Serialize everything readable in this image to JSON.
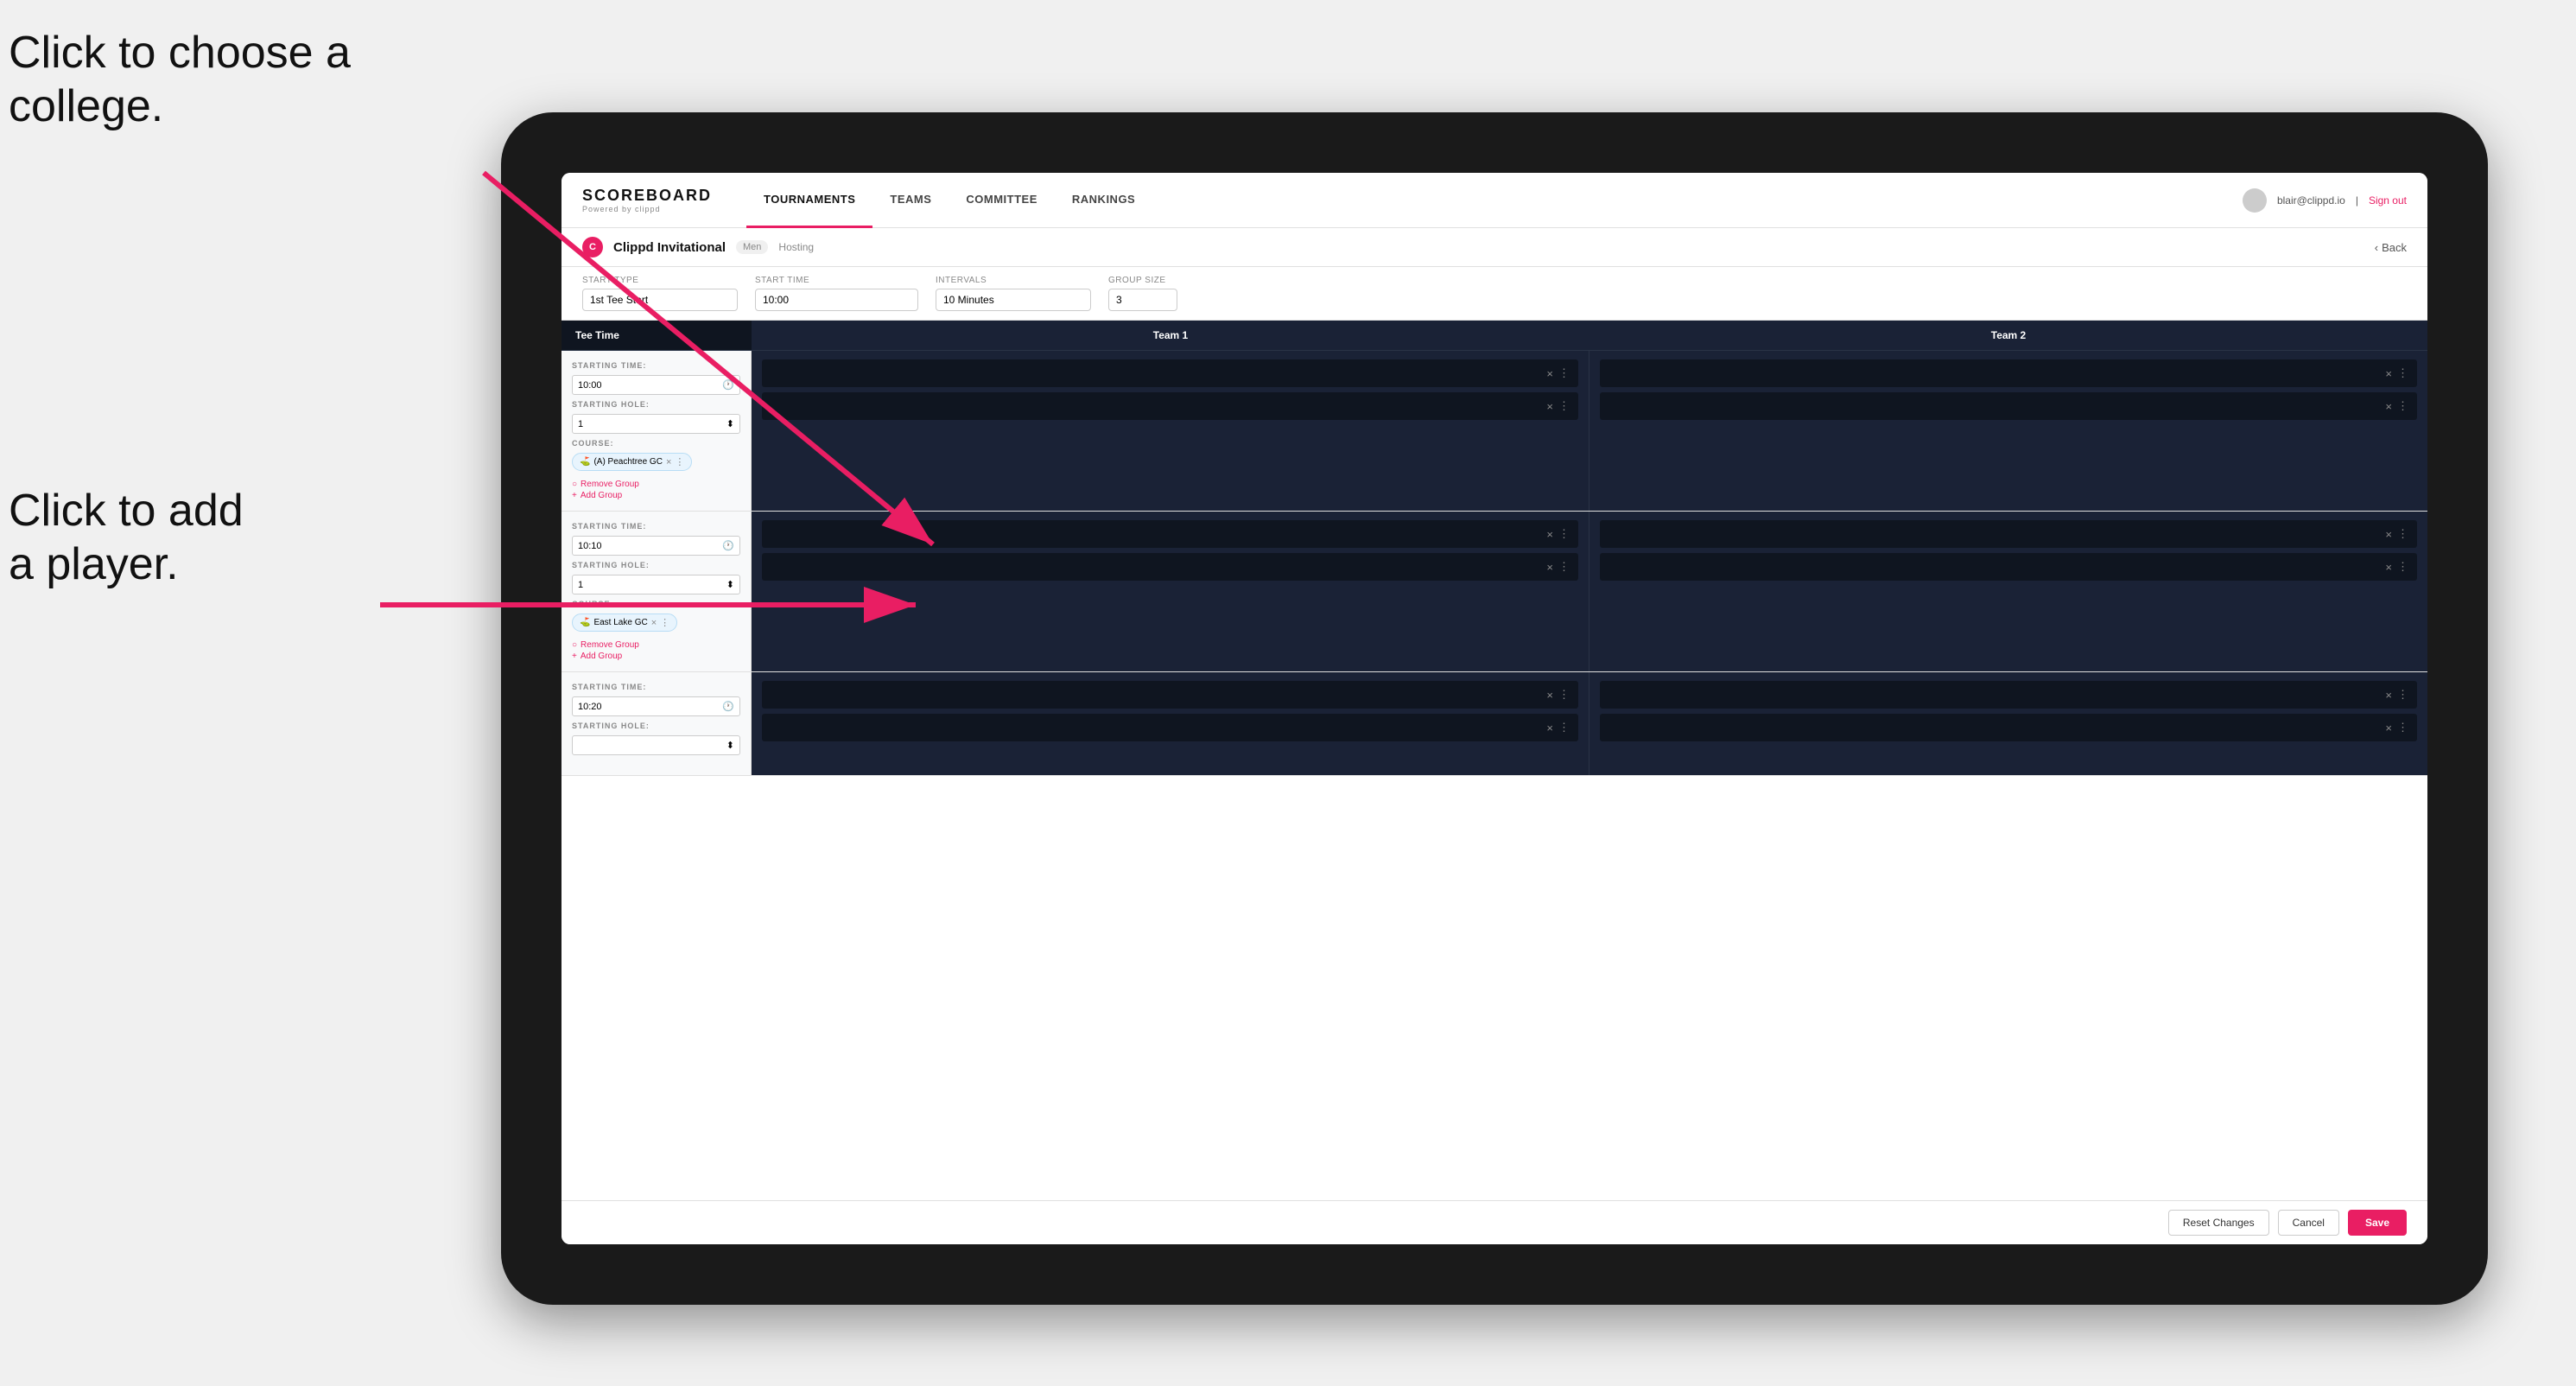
{
  "annotations": {
    "text1_line1": "Click to choose a",
    "text1_line2": "college.",
    "text2_line1": "Click to add",
    "text2_line2": "a player."
  },
  "nav": {
    "brand": "SCOREBOARD",
    "brand_sub": "Powered by clippd",
    "links": [
      "TOURNAMENTS",
      "TEAMS",
      "COMMITTEE",
      "RANKINGS"
    ],
    "active_link": "TOURNAMENTS",
    "user_email": "blair@clippd.io",
    "sign_out": "Sign out"
  },
  "sub_header": {
    "title": "Clippd Invitational",
    "badge": "Men",
    "hosting": "Hosting",
    "back": "Back"
  },
  "controls": {
    "start_type_label": "Start Type",
    "start_type_value": "1st Tee Start",
    "start_time_label": "Start Time",
    "start_time_value": "10:00",
    "intervals_label": "Intervals",
    "intervals_value": "10 Minutes",
    "group_size_label": "Group Size",
    "group_size_value": "3"
  },
  "table": {
    "col1": "Tee Time",
    "col2": "Team 1",
    "col3": "Team 2"
  },
  "groups": [
    {
      "starting_time": "10:00",
      "starting_hole": "1",
      "course": "(A) Peachtree GC",
      "team1_players": 2,
      "team2_players": 2
    },
    {
      "starting_time": "10:10",
      "starting_hole": "1",
      "course": "East Lake GC",
      "team1_players": 2,
      "team2_players": 2
    },
    {
      "starting_time": "10:20",
      "starting_hole": "",
      "course": "",
      "team1_players": 2,
      "team2_players": 2
    }
  ],
  "buttons": {
    "reset": "Reset Changes",
    "cancel": "Cancel",
    "save": "Save"
  },
  "colors": {
    "accent": "#e91e63",
    "dark_bg": "#1a2236",
    "darker_bg": "#0f1520"
  }
}
